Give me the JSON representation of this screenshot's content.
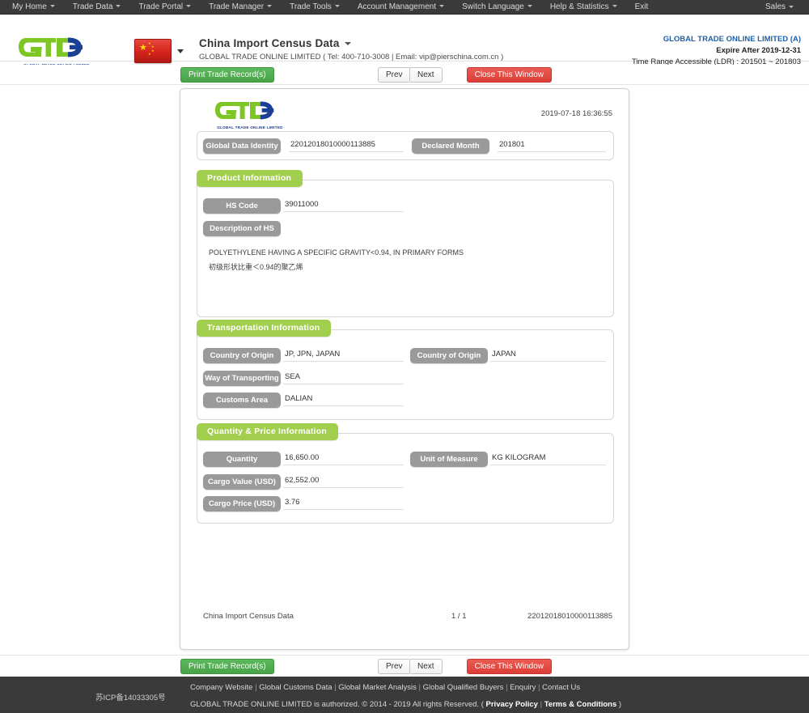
{
  "topnav": {
    "items": [
      {
        "label": "My Home",
        "caret": true
      },
      {
        "label": "Trade Data",
        "caret": true
      },
      {
        "label": "Trade Portal",
        "caret": true
      },
      {
        "label": "Trade Manager",
        "caret": true
      },
      {
        "label": "Trade Tools",
        "caret": true
      },
      {
        "label": "Account Management",
        "caret": true
      },
      {
        "label": "Switch Language",
        "caret": true
      },
      {
        "label": "Help & Statistics",
        "caret": true
      },
      {
        "label": "Exit",
        "caret": false
      }
    ],
    "right": {
      "label": "Sales",
      "caret": true
    }
  },
  "header": {
    "logo_text": "GLOBAL TRADE ONLINE LIMITED",
    "flag": "china-flag",
    "title": "China Import Census Data",
    "subtitle": "GLOBAL TRADE ONLINE LIMITED ( Tel: 400-710-3008 | Email: vip@pierschina.com.cn )",
    "account_name": "GLOBAL TRADE ONLINE LIMITED (A)",
    "expire": "Expire After 2019-12-31",
    "time_range": "Time Range Accessible (LDR) : 201501 ~ 201803"
  },
  "toolbar": {
    "print_label": "Print Trade Record(s)",
    "prev_label": "Prev",
    "next_label": "Next",
    "close_label": "Close This Window"
  },
  "record": {
    "logo_text": "GLOBAL TRADE ONLINE LIMITED",
    "timestamp": "2019-07-18 16:36:55",
    "identity_label": "Global Data Identity",
    "identity_value": "22012018010000113885",
    "declared_month_label": "Declared Month",
    "declared_month_value": "201801",
    "product": {
      "section_title": "Product Information",
      "hs_code_label": "HS Code",
      "hs_code_value": "39011000",
      "description_label": "Description of HS",
      "description_en": "POLYETHYLENE HAVING A SPECIFIC GRAVITY<0.94, IN PRIMARY FORMS",
      "description_cn": "初级形状比重＜0.94的聚乙烯"
    },
    "transportation": {
      "section_title": "Transportation Information",
      "country_code_label": "Country of Origin",
      "country_code_value": "JP, JPN, JAPAN",
      "country_name_label": "Country of Origin",
      "country_name_value": "JAPAN",
      "way_label": "Way of Transporting",
      "way_value": "SEA",
      "customs_label": "Customs Area",
      "customs_value": "DALIAN"
    },
    "quantity": {
      "section_title": "Quantity & Price Information",
      "quantity_label": "Quantity",
      "quantity_value": "16,650.00",
      "unit_label": "Unit of Measure",
      "unit_value": "KG KILOGRAM",
      "cargo_value_label": "Cargo Value (USD)",
      "cargo_value_value": "62,552.00",
      "cargo_price_label": "Cargo Price (USD)",
      "cargo_price_value": "3.76"
    },
    "footer_left": "China Import Census Data",
    "footer_page": "1 / 1",
    "footer_right": "22012018010000113885"
  },
  "footer": {
    "icp": "苏ICP备14033305号",
    "links": [
      "Company Website",
      "Global Customs Data",
      "Global Market Analysis",
      "Global Qualified Buyers",
      "Enquiry",
      "Contact Us"
    ],
    "copyright": "GLOBAL TRADE ONLINE LIMITED is authorized. © 2014 - 2019 All rights Reserved.  (",
    "privacy": "Privacy Policy",
    "terms": "Terms & Conditions",
    "close_paren": ")"
  },
  "colors": {
    "nav_bg": "#3a3a3a",
    "green": "#a2ce4e",
    "pill_grey": "#9a9a9a",
    "btn_green": "#5cb85c",
    "btn_red": "#dc3e36",
    "accent_blue": "#2060a8"
  }
}
